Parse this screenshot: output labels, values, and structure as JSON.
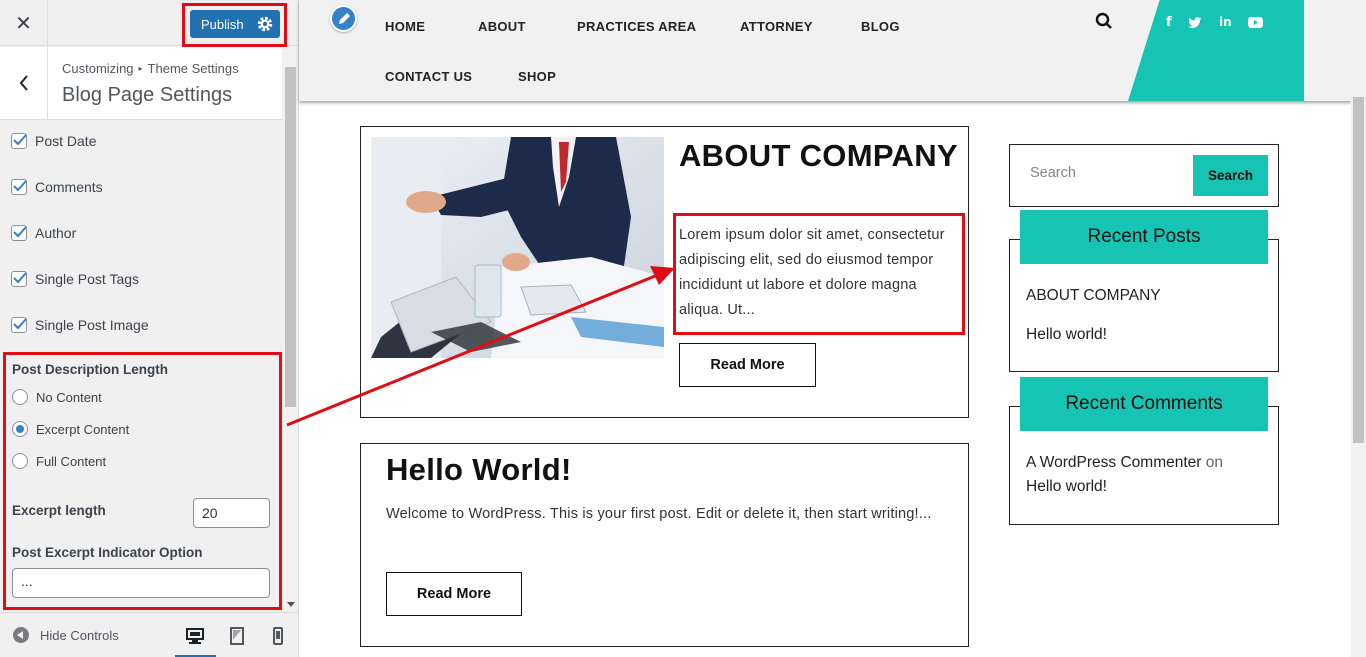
{
  "customizer": {
    "close_icon": "close-icon",
    "publish_label": "Publish",
    "breadcrumb_root": "Customizing",
    "breadcrumb_parent": "Theme Settings",
    "section_title": "Blog Page Settings",
    "checkboxes": [
      {
        "label": "Post Date",
        "checked": true
      },
      {
        "label": "Comments",
        "checked": true
      },
      {
        "label": "Author",
        "checked": true
      },
      {
        "label": "Single Post Tags",
        "checked": true
      },
      {
        "label": "Single Post Image",
        "checked": true
      }
    ],
    "desc_length_label": "Post Description Length",
    "radio_options": [
      {
        "label": "No Content",
        "selected": false
      },
      {
        "label": "Excerpt Content",
        "selected": true
      },
      {
        "label": "Full Content",
        "selected": false
      }
    ],
    "excerpt_length_label": "Excerpt length",
    "excerpt_length_value": "20",
    "indicator_label": "Post Excerpt Indicator Option",
    "indicator_value": "...",
    "hide_controls_label": "Hide Controls"
  },
  "site": {
    "nav": [
      "HOME",
      "ABOUT",
      "PRACTICES AREA",
      "ATTORNEY",
      "BLOG",
      "CONTACT US",
      "SHOP"
    ],
    "social_icons": [
      "facebook-icon",
      "twitter-icon",
      "linkedin-icon",
      "youtube-icon"
    ],
    "posts": [
      {
        "title": "ABOUT COMPANY",
        "excerpt": "Lorem ipsum dolor sit amet, consectetur adipiscing elit, sed do eiusmod tempor incididunt ut labore et dolore magna aliqua. Ut...",
        "button": "Read More"
      },
      {
        "title": "Hello World!",
        "excerpt": "Welcome to WordPress. This is your first post. Edit or delete it, then start writing!...",
        "button": "Read More"
      }
    ],
    "search": {
      "placeholder": "Search",
      "button": "Search"
    },
    "recent_posts": {
      "title": "Recent Posts",
      "items": [
        "ABOUT COMPANY",
        "Hello world!"
      ]
    },
    "recent_comments": {
      "title": "Recent Comments",
      "author": "A WordPress Commenter",
      "connector": "on",
      "post": "Hello world!"
    }
  },
  "colors": {
    "accent": "#17c3b2",
    "publish": "#2271b1",
    "highlight": "#e10d14"
  }
}
